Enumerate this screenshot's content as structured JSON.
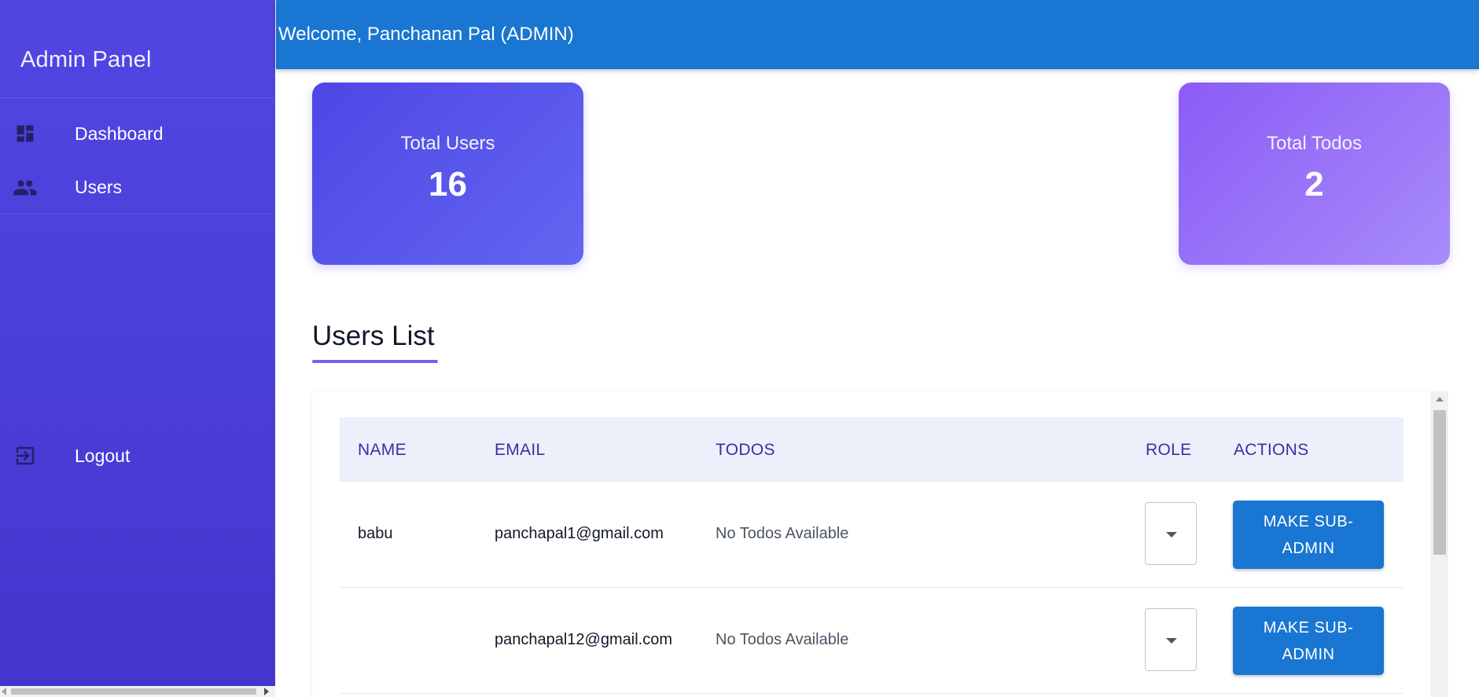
{
  "sidebar": {
    "title": "Admin Panel",
    "items": [
      {
        "label": "Dashboard",
        "icon": "dashboard-icon"
      },
      {
        "label": "Users",
        "icon": "people-icon"
      }
    ],
    "logout": {
      "label": "Logout",
      "icon": "logout-icon"
    }
  },
  "header": {
    "welcome": "Welcome, Panchanan Pal (ADMIN)"
  },
  "stats": {
    "users": {
      "label": "Total Users",
      "value": "16"
    },
    "todos": {
      "label": "Total Todos",
      "value": "2"
    }
  },
  "users_list": {
    "title": "Users List",
    "columns": {
      "name": "NAME",
      "email": "EMAIL",
      "todos": "TODOS",
      "role": "ROLE",
      "actions": "ACTIONS"
    },
    "rows": [
      {
        "name": "babu",
        "email": "panchapal1@gmail.com",
        "todos": "No Todos Available",
        "role": "",
        "action": "MAKE SUB-ADMIN"
      },
      {
        "name": "",
        "email": "panchapal12@gmail.com",
        "todos": "No Todos Available",
        "role": "",
        "action": "MAKE SUB-ADMIN"
      }
    ]
  },
  "colors": {
    "sidebar": "#4b3fd9",
    "header": "#1976d2",
    "users_card": "#4f46e5",
    "todos_card": "#8b5cf6",
    "accent_underline": "#7c5cf0",
    "table_header_text": "#3730a3"
  }
}
